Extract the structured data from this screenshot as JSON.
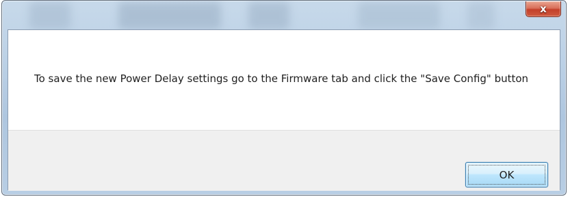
{
  "dialog": {
    "message": "To save the new Power Delay settings go to the Firmware tab and click the \"Save Config\" button",
    "close_symbol": "x",
    "buttons": {
      "ok_label": "OK"
    }
  },
  "icons": {
    "close": "close-icon"
  },
  "colors": {
    "close_button": "#c3402a",
    "title_bar": "#bcd1e6",
    "client_background": "#ffffff",
    "button_strip": "#f0f0f0",
    "ok_button_border": "#3c7fb1"
  }
}
